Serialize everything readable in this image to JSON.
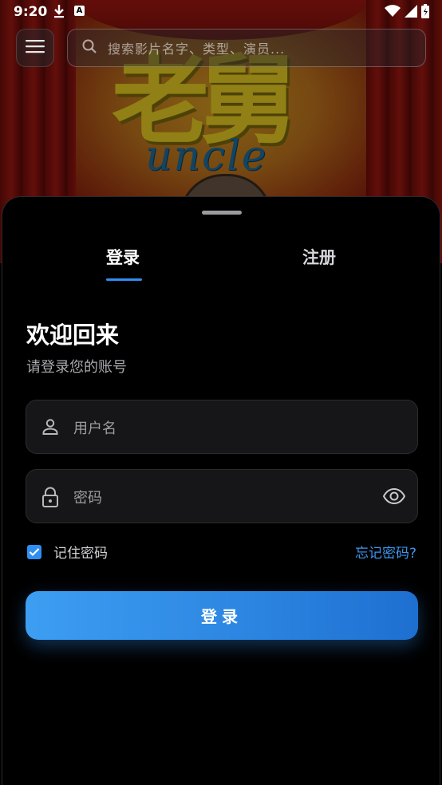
{
  "status_bar": {
    "time": "9:20",
    "icons": [
      "download-icon",
      "a-badge-icon",
      "wifi-icon",
      "signal-icon",
      "battery-icon"
    ],
    "a_badge": "A"
  },
  "poster": {
    "title_glyphs": "老舅",
    "subtitle": "uncle"
  },
  "top_bar": {
    "menu_icon": "menu-icon",
    "search_placeholder": "搜索影片名字、类型、演员..."
  },
  "auth": {
    "tabs": [
      {
        "label": "登录",
        "active": true
      },
      {
        "label": "注册",
        "active": false
      }
    ],
    "welcome_title": "欢迎回来",
    "welcome_subtitle": "请登录您的账号",
    "username_placeholder": "用户名",
    "password_placeholder": "密码",
    "remember_label": "记住密码",
    "remember_checked": true,
    "forgot_label": "忘记密码?",
    "submit_label": "登录"
  },
  "colors": {
    "accent": "#2f8ef0",
    "background": "#000000",
    "field_bg": "#161618"
  }
}
